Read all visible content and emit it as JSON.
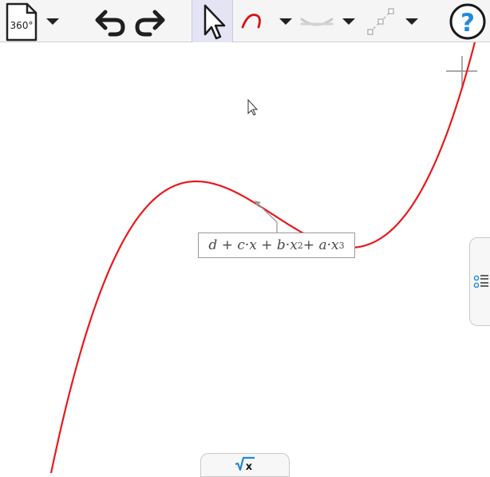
{
  "toolbar": {
    "file_icon_label": "360°",
    "items": [
      {
        "name": "file-menu",
        "icon": "file-360-icon"
      },
      {
        "name": "file-dropdown",
        "icon": "chevron-down-icon"
      },
      {
        "name": "undo",
        "icon": "undo-icon"
      },
      {
        "name": "redo",
        "icon": "redo-icon"
      },
      {
        "name": "select-tool",
        "icon": "pointer-icon",
        "active": true
      },
      {
        "name": "pen-tool",
        "icon": "pen-stroke-icon"
      },
      {
        "name": "pen-dropdown",
        "icon": "chevron-down-icon"
      },
      {
        "name": "curve-tool",
        "icon": "curve-icon"
      },
      {
        "name": "curve-dropdown",
        "icon": "chevron-down-icon"
      },
      {
        "name": "points-tool",
        "icon": "points-icon"
      },
      {
        "name": "points-dropdown",
        "icon": "chevron-down-icon"
      },
      {
        "name": "help",
        "icon": "help-icon"
      }
    ]
  },
  "canvas": {
    "curve_color": "#e8191b",
    "formula_parts": {
      "part1": "d + c·x + b·x",
      "exp1": "2",
      "part2": " + a·x",
      "exp2": "3"
    }
  },
  "side_panel": {
    "icon": "list-icon"
  },
  "bottom_panel": {
    "icon": "sqrt-x-icon",
    "label": "√x"
  },
  "colors": {
    "toolbar_bg": "#f5f5f5",
    "active_tool_bg": "#e4e4f4",
    "help_blue": "#1e8bd8"
  }
}
